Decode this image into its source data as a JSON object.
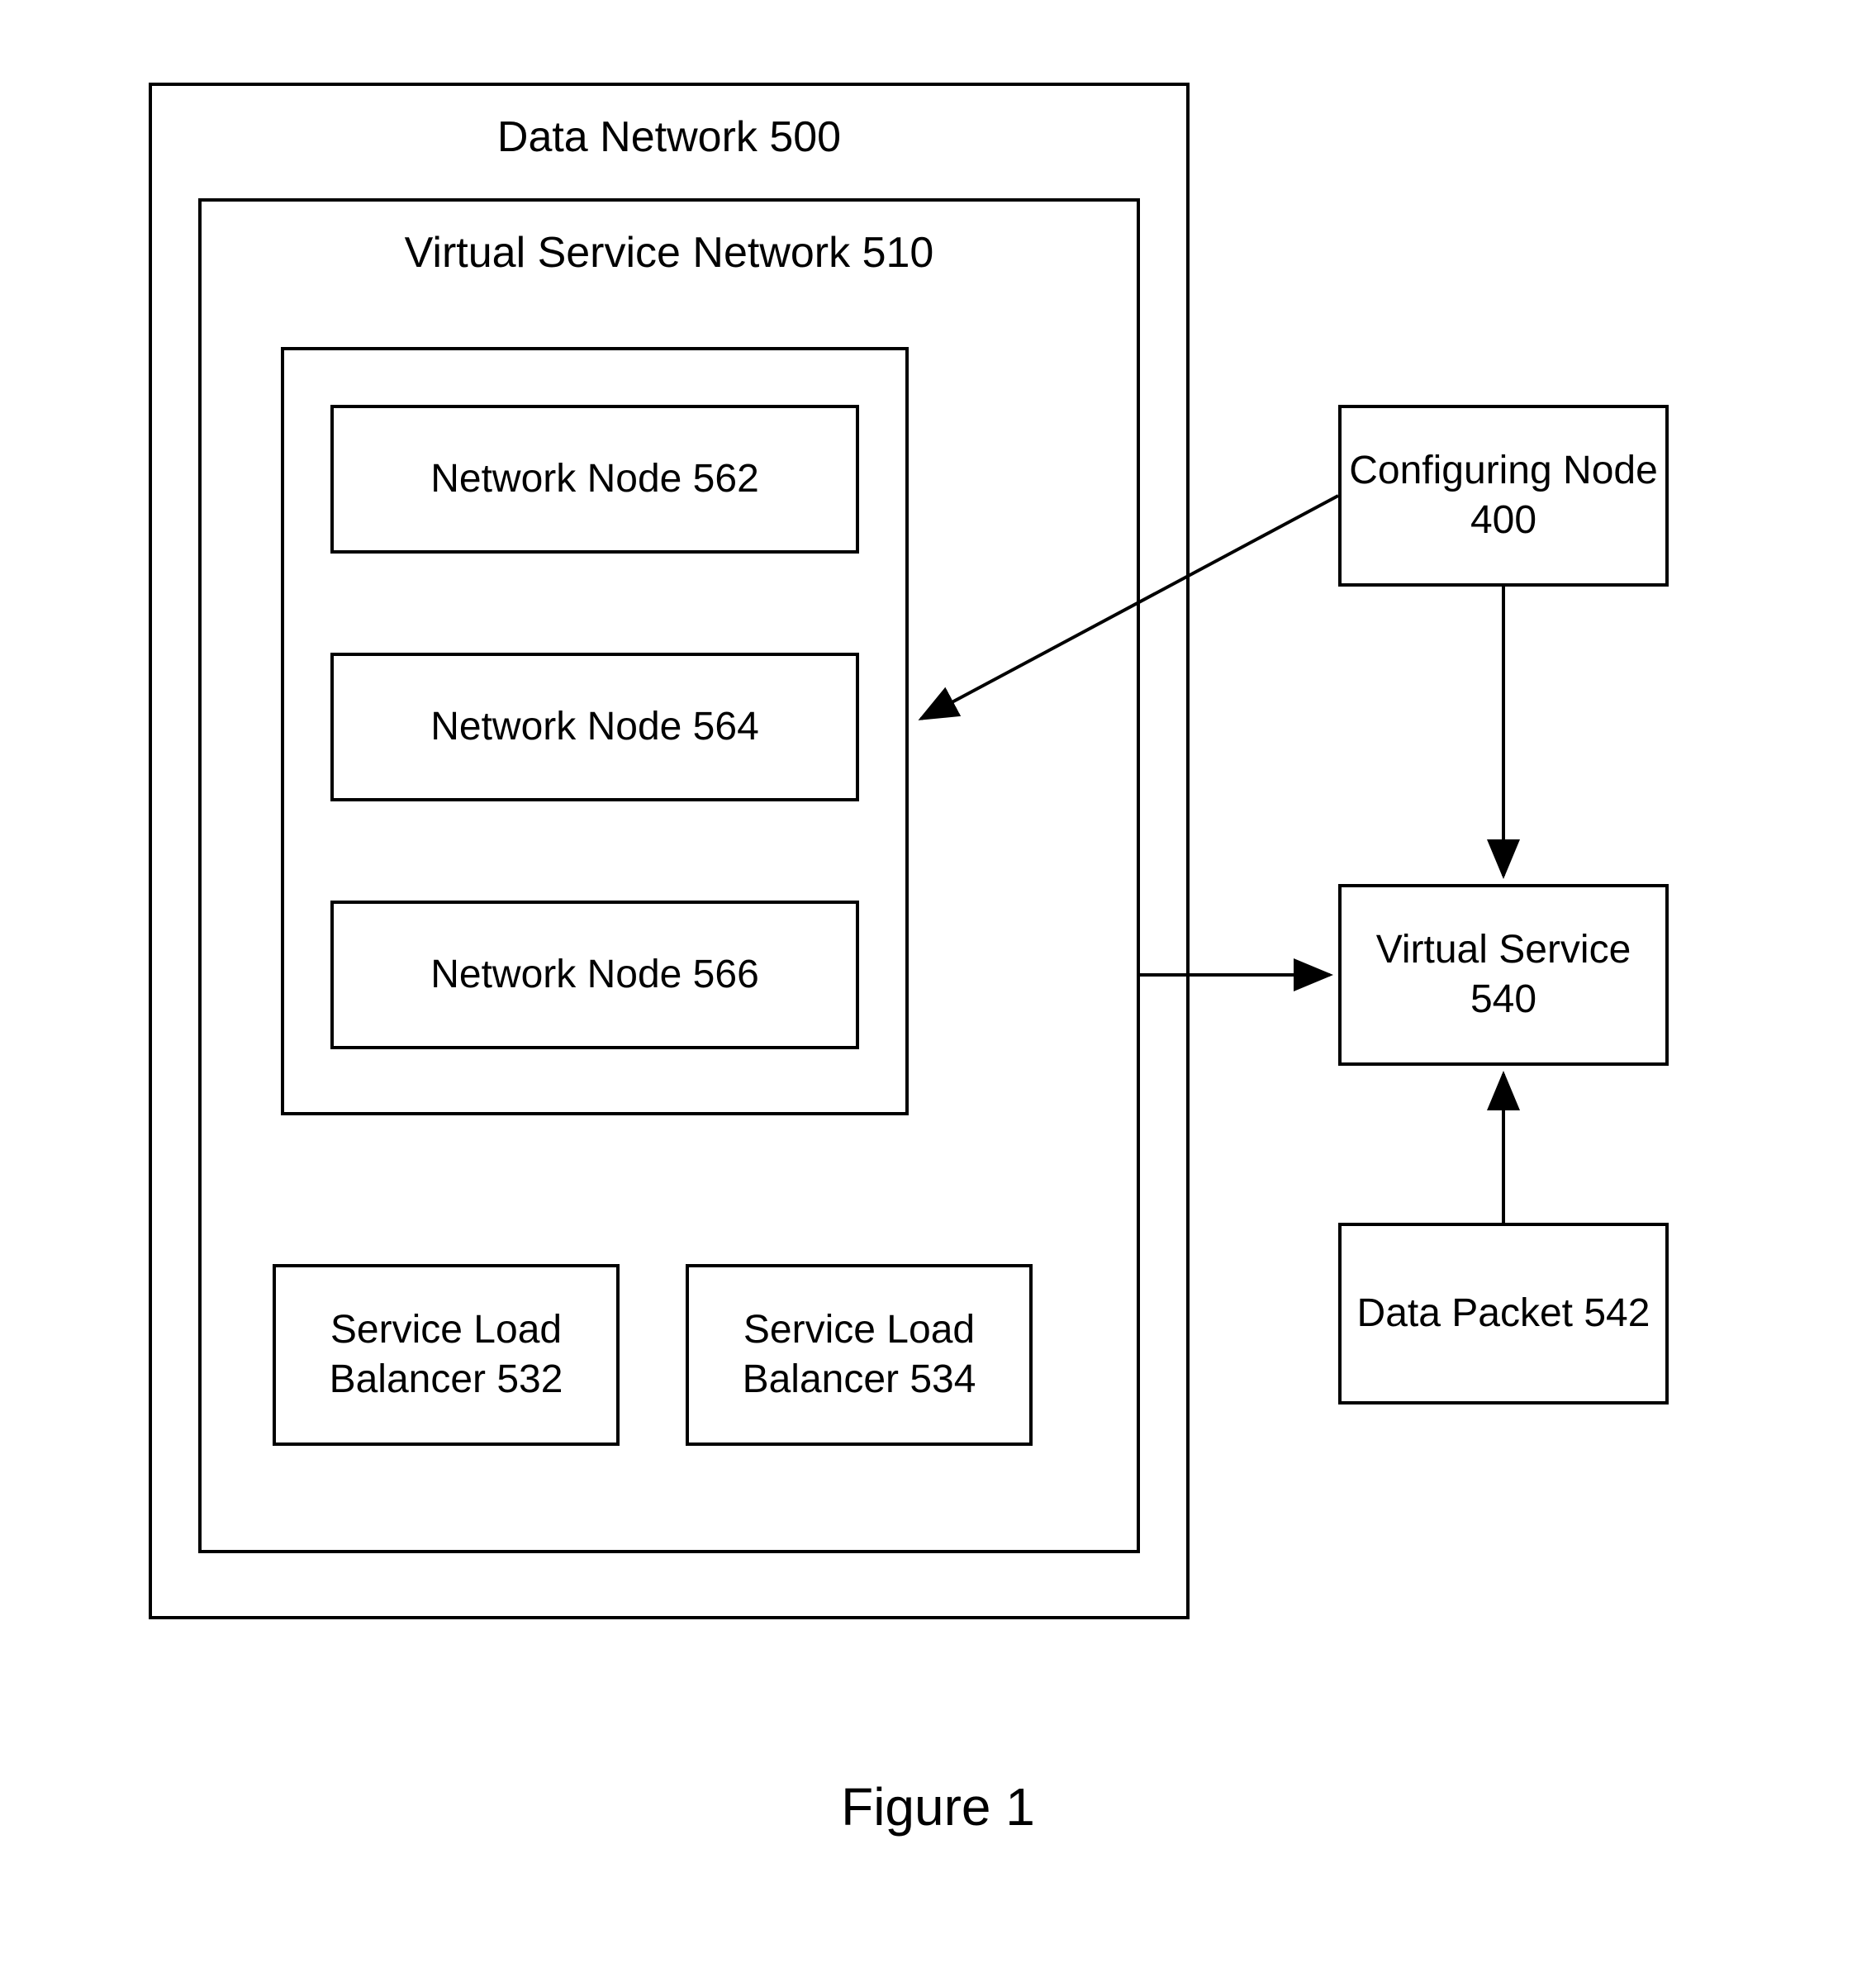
{
  "outer": {
    "title": "Data Network 500"
  },
  "vsn": {
    "title": "Virtual Service Network 510"
  },
  "nodes": {
    "n1": "Network Node 562",
    "n2": "Network Node 564",
    "n3": "Network Node 566"
  },
  "balancers": {
    "b1": "Service Load Balancer 532",
    "b2": "Service Load Balancer 534"
  },
  "config": {
    "label": "Configuring Node 400"
  },
  "vserv": {
    "label": "Virtual Service 540"
  },
  "packet": {
    "label": "Data Packet 542"
  },
  "caption": "Figure 1"
}
